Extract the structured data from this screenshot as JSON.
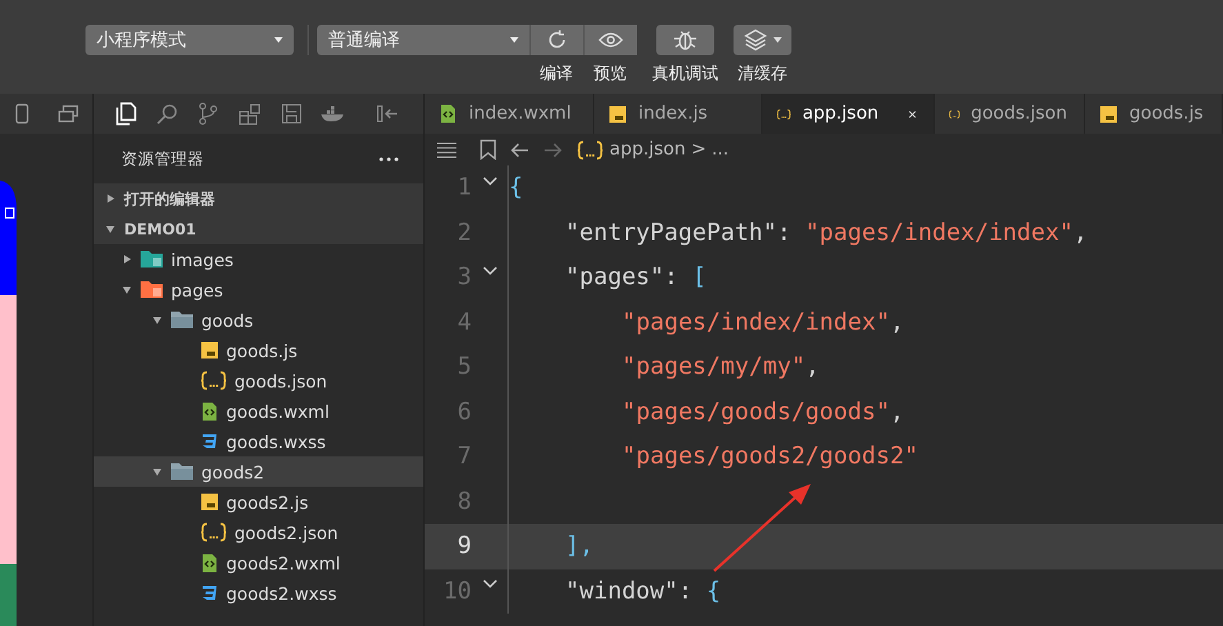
{
  "toolbar": {
    "mode_select": "小程序模式",
    "compile_select": "普通编译",
    "buttons": [
      {
        "label": "编译"
      },
      {
        "label": "预览"
      },
      {
        "label": "真机调试"
      },
      {
        "label": "清缓存"
      }
    ]
  },
  "tabs": [
    {
      "label": "index.wxml",
      "kind": "wxml",
      "selected": false
    },
    {
      "label": "index.js",
      "kind": "js",
      "selected": false
    },
    {
      "label": "app.json",
      "kind": "json",
      "selected": true
    },
    {
      "label": "goods.json",
      "kind": "json",
      "selected": false
    },
    {
      "label": "goods.js",
      "kind": "js",
      "selected": false
    }
  ],
  "explorer": {
    "title": "资源管理器",
    "sections": [
      {
        "label": "打开的编辑器",
        "expanded": false
      },
      {
        "label": "DEMO01",
        "expanded": true
      }
    ],
    "tree": [
      {
        "label": "images",
        "kind": "imagesfolder",
        "expanded": false,
        "selected": false
      },
      {
        "label": "pages",
        "kind": "pagesfolder",
        "expanded": true,
        "selected": false,
        "children": [
          {
            "label": "goods",
            "kind": "folder",
            "expanded": true,
            "selected": false,
            "children": [
              {
                "label": "goods.js",
                "kind": "js",
                "selected": false
              },
              {
                "label": "goods.json",
                "kind": "json",
                "selected": false
              },
              {
                "label": "goods.wxml",
                "kind": "wxml",
                "selected": false
              },
              {
                "label": "goods.wxss",
                "kind": "wxss",
                "selected": false
              }
            ]
          },
          {
            "label": "goods2",
            "kind": "folder",
            "expanded": true,
            "selected": true,
            "children": [
              {
                "label": "goods2.js",
                "kind": "js",
                "selected": false
              },
              {
                "label": "goods2.json",
                "kind": "json",
                "selected": false
              },
              {
                "label": "goods2.wxml",
                "kind": "wxml",
                "selected": false
              },
              {
                "label": "goods2.wxss",
                "kind": "wxss",
                "selected": false
              }
            ]
          }
        ]
      }
    ]
  },
  "breadcrumb": {
    "file": "app.json",
    "separator": ">",
    "more": "..."
  },
  "code": [
    {
      "number": "1",
      "fold": true,
      "current": false,
      "tokens": [
        {
          "text": "{",
          "kind": "brace"
        }
      ],
      "children": [
        {
          "number": "2",
          "fold": false,
          "current": false,
          "tokens": [
            {
              "text": "\"entryPagePath\"",
              "kind": "key"
            },
            {
              "text": ": ",
              "kind": "punct"
            },
            {
              "text": "\"pages/index/index\"",
              "kind": "string"
            },
            {
              "text": ",",
              "kind": "punct"
            }
          ]
        },
        {
          "number": "3",
          "fold": true,
          "current": false,
          "tokens": [
            {
              "text": "\"pages\"",
              "kind": "key"
            },
            {
              "text": ": ",
              "kind": "punct"
            },
            {
              "text": "[",
              "kind": "brace"
            }
          ],
          "children": [
            {
              "number": "4",
              "fold": false,
              "current": false,
              "tokens": [
                {
                  "text": "\"pages/index/index\"",
                  "kind": "string"
                },
                {
                  "text": ",",
                  "kind": "punct"
                }
              ]
            },
            {
              "number": "5",
              "fold": false,
              "current": false,
              "tokens": [
                {
                  "text": "\"pages/my/my\"",
                  "kind": "string"
                },
                {
                  "text": ",",
                  "kind": "punct"
                }
              ]
            },
            {
              "number": "6",
              "fold": false,
              "current": false,
              "tokens": [
                {
                  "text": "\"pages/goods/goods\"",
                  "kind": "string"
                },
                {
                  "text": ",",
                  "kind": "punct"
                }
              ]
            },
            {
              "number": "7",
              "fold": false,
              "current": false,
              "tokens": [
                {
                  "text": "\"pages/goods2/goods2\"",
                  "kind": "string"
                }
              ]
            },
            {
              "number": "8",
              "fold": false,
              "current": false
            }
          ]
        },
        {
          "number": "9",
          "fold": false,
          "current": true,
          "tokens": [
            {
              "text": "],",
              "kind": "brace"
            }
          ]
        },
        {
          "number": "10",
          "fold": true,
          "current": false,
          "tokens": [
            {
              "text": "\"window\"",
              "kind": "key"
            },
            {
              "text": ": ",
              "kind": "punct"
            },
            {
              "text": "{",
              "kind": "brace"
            }
          ]
        }
      ]
    }
  ]
}
